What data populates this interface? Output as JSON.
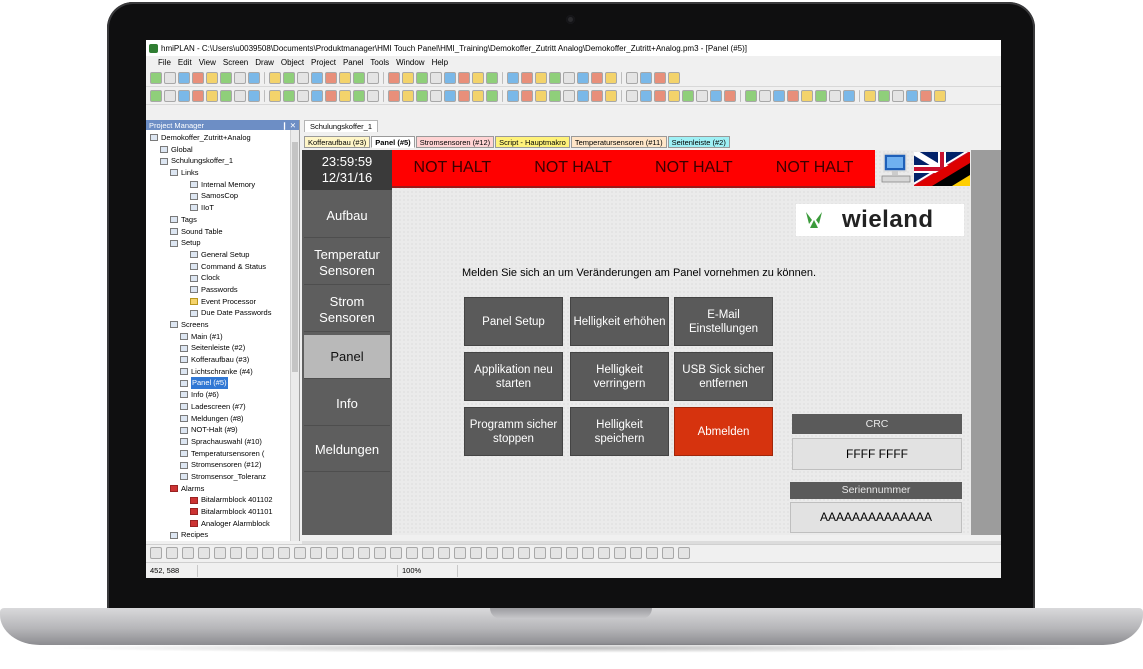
{
  "window": {
    "title": "hmiPLAN - C:\\Users\\u0039508\\Documents\\Produktmanager\\HMI Touch Panel\\HMI_Training\\Demokoffer_Zutritt Analog\\Demokoffer_Zutritt+Analog.pm3 - [Panel (#5)]"
  },
  "menu": [
    "File",
    "Edit",
    "View",
    "Screen",
    "Draw",
    "Object",
    "Project",
    "Panel",
    "Tools",
    "Window",
    "Help"
  ],
  "project_manager": {
    "title": "Project Manager",
    "pin": "❙ ✕",
    "tree": [
      {
        "label": "Demokoffer_Zutritt+Analog",
        "indent": 0,
        "icon": ""
      },
      {
        "label": "Global",
        "indent": 1,
        "icon": ""
      },
      {
        "label": "Schulungskoffer_1",
        "indent": 1,
        "icon": ""
      },
      {
        "label": "Links",
        "indent": 2,
        "icon": ""
      },
      {
        "label": "Internal Memory",
        "indent": 4,
        "icon": ""
      },
      {
        "label": "SamosCop",
        "indent": 4,
        "icon": ""
      },
      {
        "label": "IIoT",
        "indent": 4,
        "icon": ""
      },
      {
        "label": "Tags",
        "indent": 2,
        "icon": ""
      },
      {
        "label": "Sound Table",
        "indent": 2,
        "icon": ""
      },
      {
        "label": "Setup",
        "indent": 2,
        "icon": ""
      },
      {
        "label": "General Setup",
        "indent": 4,
        "icon": ""
      },
      {
        "label": "Command & Status",
        "indent": 4,
        "icon": ""
      },
      {
        "label": "Clock",
        "indent": 4,
        "icon": ""
      },
      {
        "label": "Passwords",
        "indent": 4,
        "icon": ""
      },
      {
        "label": "Event Processor",
        "indent": 4,
        "icon": "yellow"
      },
      {
        "label": "Due Date Passwords",
        "indent": 4,
        "icon": ""
      },
      {
        "label": "Screens",
        "indent": 2,
        "icon": ""
      },
      {
        "label": "Main (#1)",
        "indent": 3,
        "icon": ""
      },
      {
        "label": "Seitenleiste (#2)",
        "indent": 3,
        "icon": ""
      },
      {
        "label": "Kofferaufbau (#3)",
        "indent": 3,
        "icon": ""
      },
      {
        "label": "Lichtschranke (#4)",
        "indent": 3,
        "icon": ""
      },
      {
        "label": "Panel (#5)",
        "indent": 3,
        "icon": "",
        "selected": true
      },
      {
        "label": "Info (#6)",
        "indent": 3,
        "icon": ""
      },
      {
        "label": "Ladescreen (#7)",
        "indent": 3,
        "icon": ""
      },
      {
        "label": "Meldungen (#8)",
        "indent": 3,
        "icon": ""
      },
      {
        "label": "NOT-Halt (#9)",
        "indent": 3,
        "icon": ""
      },
      {
        "label": "Sprachauswahl (#10)",
        "indent": 3,
        "icon": ""
      },
      {
        "label": "Temperatursensoren (",
        "indent": 3,
        "icon": ""
      },
      {
        "label": "Stromsensoren (#12)",
        "indent": 3,
        "icon": ""
      },
      {
        "label": "Stromsensor_Toleranz",
        "indent": 3,
        "icon": ""
      },
      {
        "label": "Alarms",
        "indent": 2,
        "icon": "red"
      },
      {
        "label": "Bitalarmblock 401102",
        "indent": 4,
        "icon": "red"
      },
      {
        "label": "Bitalarmblock 401101",
        "indent": 4,
        "icon": "red"
      },
      {
        "label": "Analoger Alarmblock",
        "indent": 4,
        "icon": "red"
      },
      {
        "label": "Recipes",
        "indent": 2,
        "icon": ""
      }
    ]
  },
  "editor": {
    "doc_tab": "Schulungskoffer_1",
    "screen_tabs": [
      {
        "label": "Kofferaufbau (#3)",
        "color": "#fff6c8"
      },
      {
        "label": "Panel (#5)",
        "color": "#ffffff",
        "active": true
      },
      {
        "label": "Stromsensoren (#12)",
        "color": "#ffd3d3"
      },
      {
        "label": "Script - Hauptmakro",
        "color": "#fff27a"
      },
      {
        "label": "Temperatursensoren (#11)",
        "color": "#ffe6c8"
      },
      {
        "label": "Seitenleiste (#2)",
        "color": "#9ff0f5"
      }
    ]
  },
  "hmi": {
    "time": "23:59:59",
    "date": "12/31/16",
    "nav": [
      "Aufbau",
      "Temperatur Sensoren",
      "Strom Sensoren",
      "Panel",
      "Info",
      "Meldungen"
    ],
    "nav_active_index": 3,
    "alarm_texts": [
      "NOT HALT",
      "NOT HALT",
      "NOT HALT",
      "NOT HALT"
    ],
    "logo_text": "wieland",
    "message": "Melden Sie sich an um Veränderungen am Panel vornehmen zu können.",
    "buttons": [
      {
        "label": "Panel Setup"
      },
      {
        "label": "Helligkeit erhöhen"
      },
      {
        "label": "E-Mail Einstellungen"
      },
      {
        "label": "Applikation neu starten"
      },
      {
        "label": "Helligkeit verringern"
      },
      {
        "label": "USB Sick sicher entfernen"
      },
      {
        "label": "Programm sicher stoppen"
      },
      {
        "label": "Helligkeit speichern"
      },
      {
        "label": "Abmelden",
        "style": "red"
      }
    ],
    "crc_label": "CRC",
    "crc_value": "FFFF FFFF",
    "serial_label": "Seriennummer",
    "serial_value": "AAAAAAAAAAAAAA",
    "colors": {
      "alarm": "#ff0000",
      "logout": "#d6330e",
      "button": "#5a5a5a"
    }
  },
  "statusbar": {
    "coords": "452, 588",
    "zoom": "100%"
  }
}
